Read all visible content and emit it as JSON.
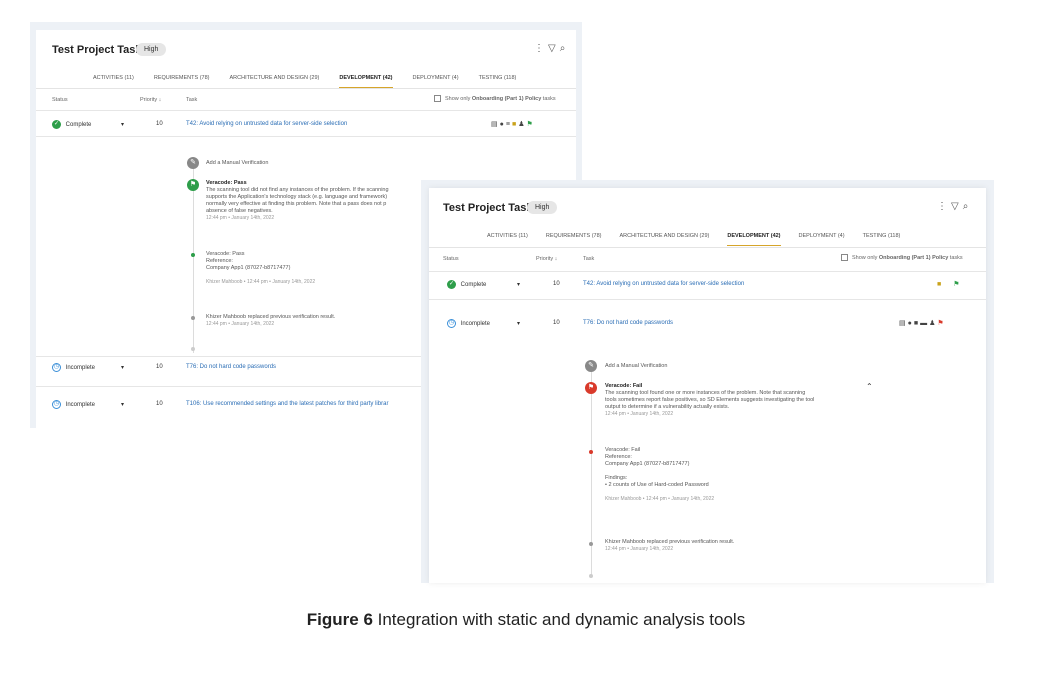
{
  "caption": {
    "label": "Figure 6",
    "text": " Integration with static and dynamic analysis tools"
  },
  "common": {
    "title": "Test Project Tasks",
    "badge": "High",
    "tabs": [
      "ACTIVITIES (11)",
      "REQUIREMENTS (78)",
      "ARCHITECTURE AND DESIGN (29)",
      "DEVELOPMENT (42)",
      "DEPLOYMENT (4)",
      "TESTING (118)"
    ],
    "active_tab": "DEVELOPMENT (42)",
    "col_status": "Status",
    "col_priority": "Priority",
    "col_task": "Task",
    "filter_label_a": "Show only ",
    "filter_label_b": "Onboarding (Part 1) Policy",
    "filter_label_c": " tasks",
    "add_manual": "Add a Manual Verification"
  },
  "back": {
    "rows": [
      {
        "status": "Complete",
        "priority": "10",
        "task": "T42: Avoid relying on untrusted data for server-side selection"
      },
      {
        "status": "Incomplete",
        "priority": "10",
        "task": "T76: Do not hard code passwords"
      },
      {
        "status": "Incomplete",
        "priority": "10",
        "task": "T106: Use recommended settings and the latest patches for third party librar"
      }
    ],
    "verif_title": "Veracode: Pass",
    "verif_text_1": "The scanning tool did not find any instances of the problem. If the scanning",
    "verif_text_2": "supports the Application's technology stack (e.g. language and framework)",
    "verif_text_3": "normally very effective at finding this problem. Note that a pass does not p",
    "verif_text_4": "absence of false negatives.",
    "verif_time": "12:44 pm • January 14th, 2022",
    "entry_title": "Veracode: Pass",
    "entry_ref": "Reference:",
    "entry_app": "Company App1 (87027-b8717477)",
    "entry_meta": "Khizer Mahboob • 12:44 pm • January 14th, 2022",
    "replaced": "Khizer Mahboob replaced previous verification result.",
    "replaced_time": "12:44 pm • January 14th, 2022"
  },
  "front": {
    "rows": [
      {
        "status": "Complete",
        "priority": "10",
        "task": "T42: Avoid relying on untrusted data for server-side selection"
      },
      {
        "status": "Incomplete",
        "priority": "10",
        "task": "T76: Do not hard code passwords"
      }
    ],
    "verif_title": "Veracode: Fail",
    "verif_text_1": "The scanning tool found one or more instances of the problem. Note that scanning",
    "verif_text_2": "tools sometimes report false positives, so SD Elements suggests investigating the tool",
    "verif_text_3": "output to determine if a vulnerability actually exists.",
    "verif_time": "12:44 pm • January 14th, 2022",
    "entry_title": "Veracode: Fail",
    "entry_ref": "Reference:",
    "entry_app": "Company App1 (87027-b8717477)",
    "findings_label": "Findings:",
    "findings_item": "2 counts of Use of Hard-coded Password",
    "entry_meta": "Khizer Mahboob • 12:44 pm • January 14th, 2022",
    "replaced": "Khizer Mahboob replaced previous verification result.",
    "replaced_time": "12:44 pm • January 14th, 2022"
  },
  "colors": {
    "accent_tab": "#d6a52a",
    "link": "#2a6db5",
    "complete": "#2e9e4a",
    "incomplete": "#3a8fd8",
    "fail": "#d93a2b"
  }
}
